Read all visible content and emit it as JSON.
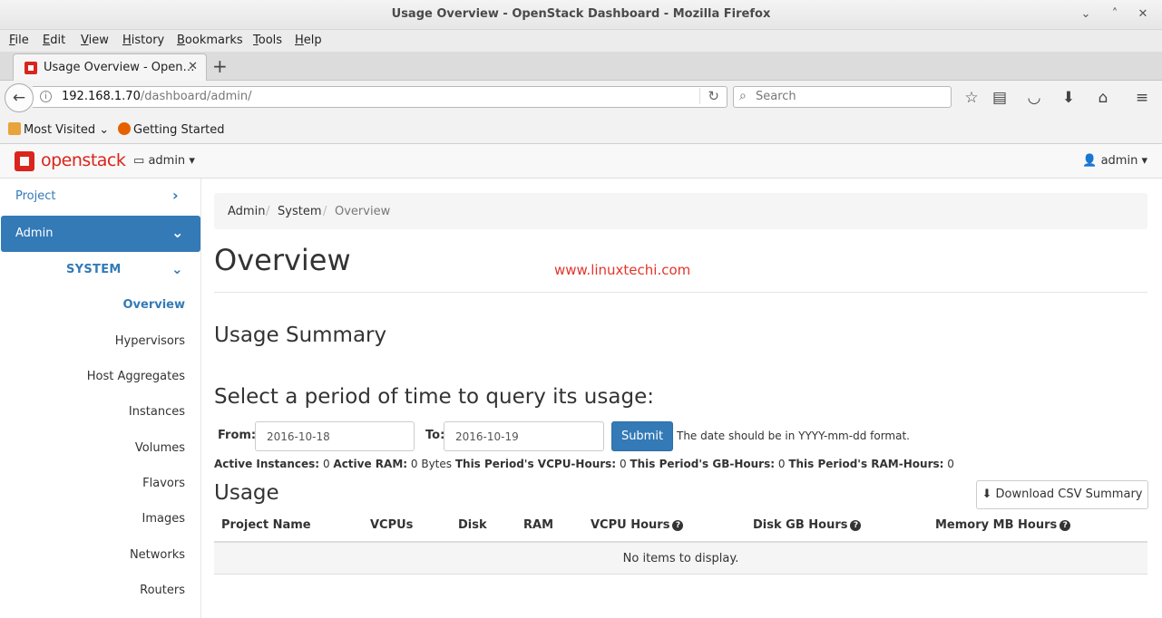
{
  "window": {
    "title": "Usage Overview - OpenStack Dashboard - Mozilla Firefox"
  },
  "menu": [
    "File",
    "Edit",
    "View",
    "History",
    "Bookmarks",
    "Tools",
    "Help"
  ],
  "tab": {
    "label": "Usage Overview - Open…"
  },
  "address": {
    "host": "192.168.1.70",
    "path": "/dashboard/admin/"
  },
  "search": {
    "placeholder": "Search"
  },
  "bookmarks": {
    "most_visited": "Most Visited",
    "getting_started": "Getting Started"
  },
  "header": {
    "logo": "openstack",
    "project": "admin",
    "user": "admin"
  },
  "sidebar": {
    "project": "Project",
    "admin": "Admin",
    "system": "SYSTEM",
    "items": [
      "Overview",
      "Hypervisors",
      "Host Aggregates",
      "Instances",
      "Volumes",
      "Flavors",
      "Images",
      "Networks",
      "Routers"
    ]
  },
  "breadcrumb": [
    "Admin",
    "System",
    "Overview"
  ],
  "page": {
    "title": "Overview",
    "watermark": "www.linuxtechi.com",
    "usage_summary": "Usage Summary",
    "period_heading": "Select a period of time to query its usage:",
    "from_label": "From:",
    "from_value": "2016-10-18",
    "to_label": "To:",
    "to_value": "2016-10-19",
    "submit": "Submit",
    "hint": "The date should be in YYYY-mm-dd format.",
    "stats": {
      "active_instances_label": "Active Instances:",
      "active_instances": "0",
      "active_ram_label": "Active RAM:",
      "active_ram": "0 Bytes",
      "vcpu_hours_label": "This Period's VCPU-Hours:",
      "vcpu_hours": "0",
      "gb_hours_label": "This Period's GB-Hours:",
      "gb_hours": "0",
      "ram_hours_label": "This Period's RAM-Hours:",
      "ram_hours": "0"
    },
    "usage_heading": "Usage",
    "csv_button": "Download CSV Summary",
    "columns": [
      "Project Name",
      "VCPUs",
      "Disk",
      "RAM",
      "VCPU Hours",
      "Disk GB Hours",
      "Memory MB Hours"
    ],
    "empty": "No items to display."
  },
  "colors": {
    "accent": "#337ab7",
    "brand": "#d9251d",
    "watermark": "#e2352b"
  }
}
